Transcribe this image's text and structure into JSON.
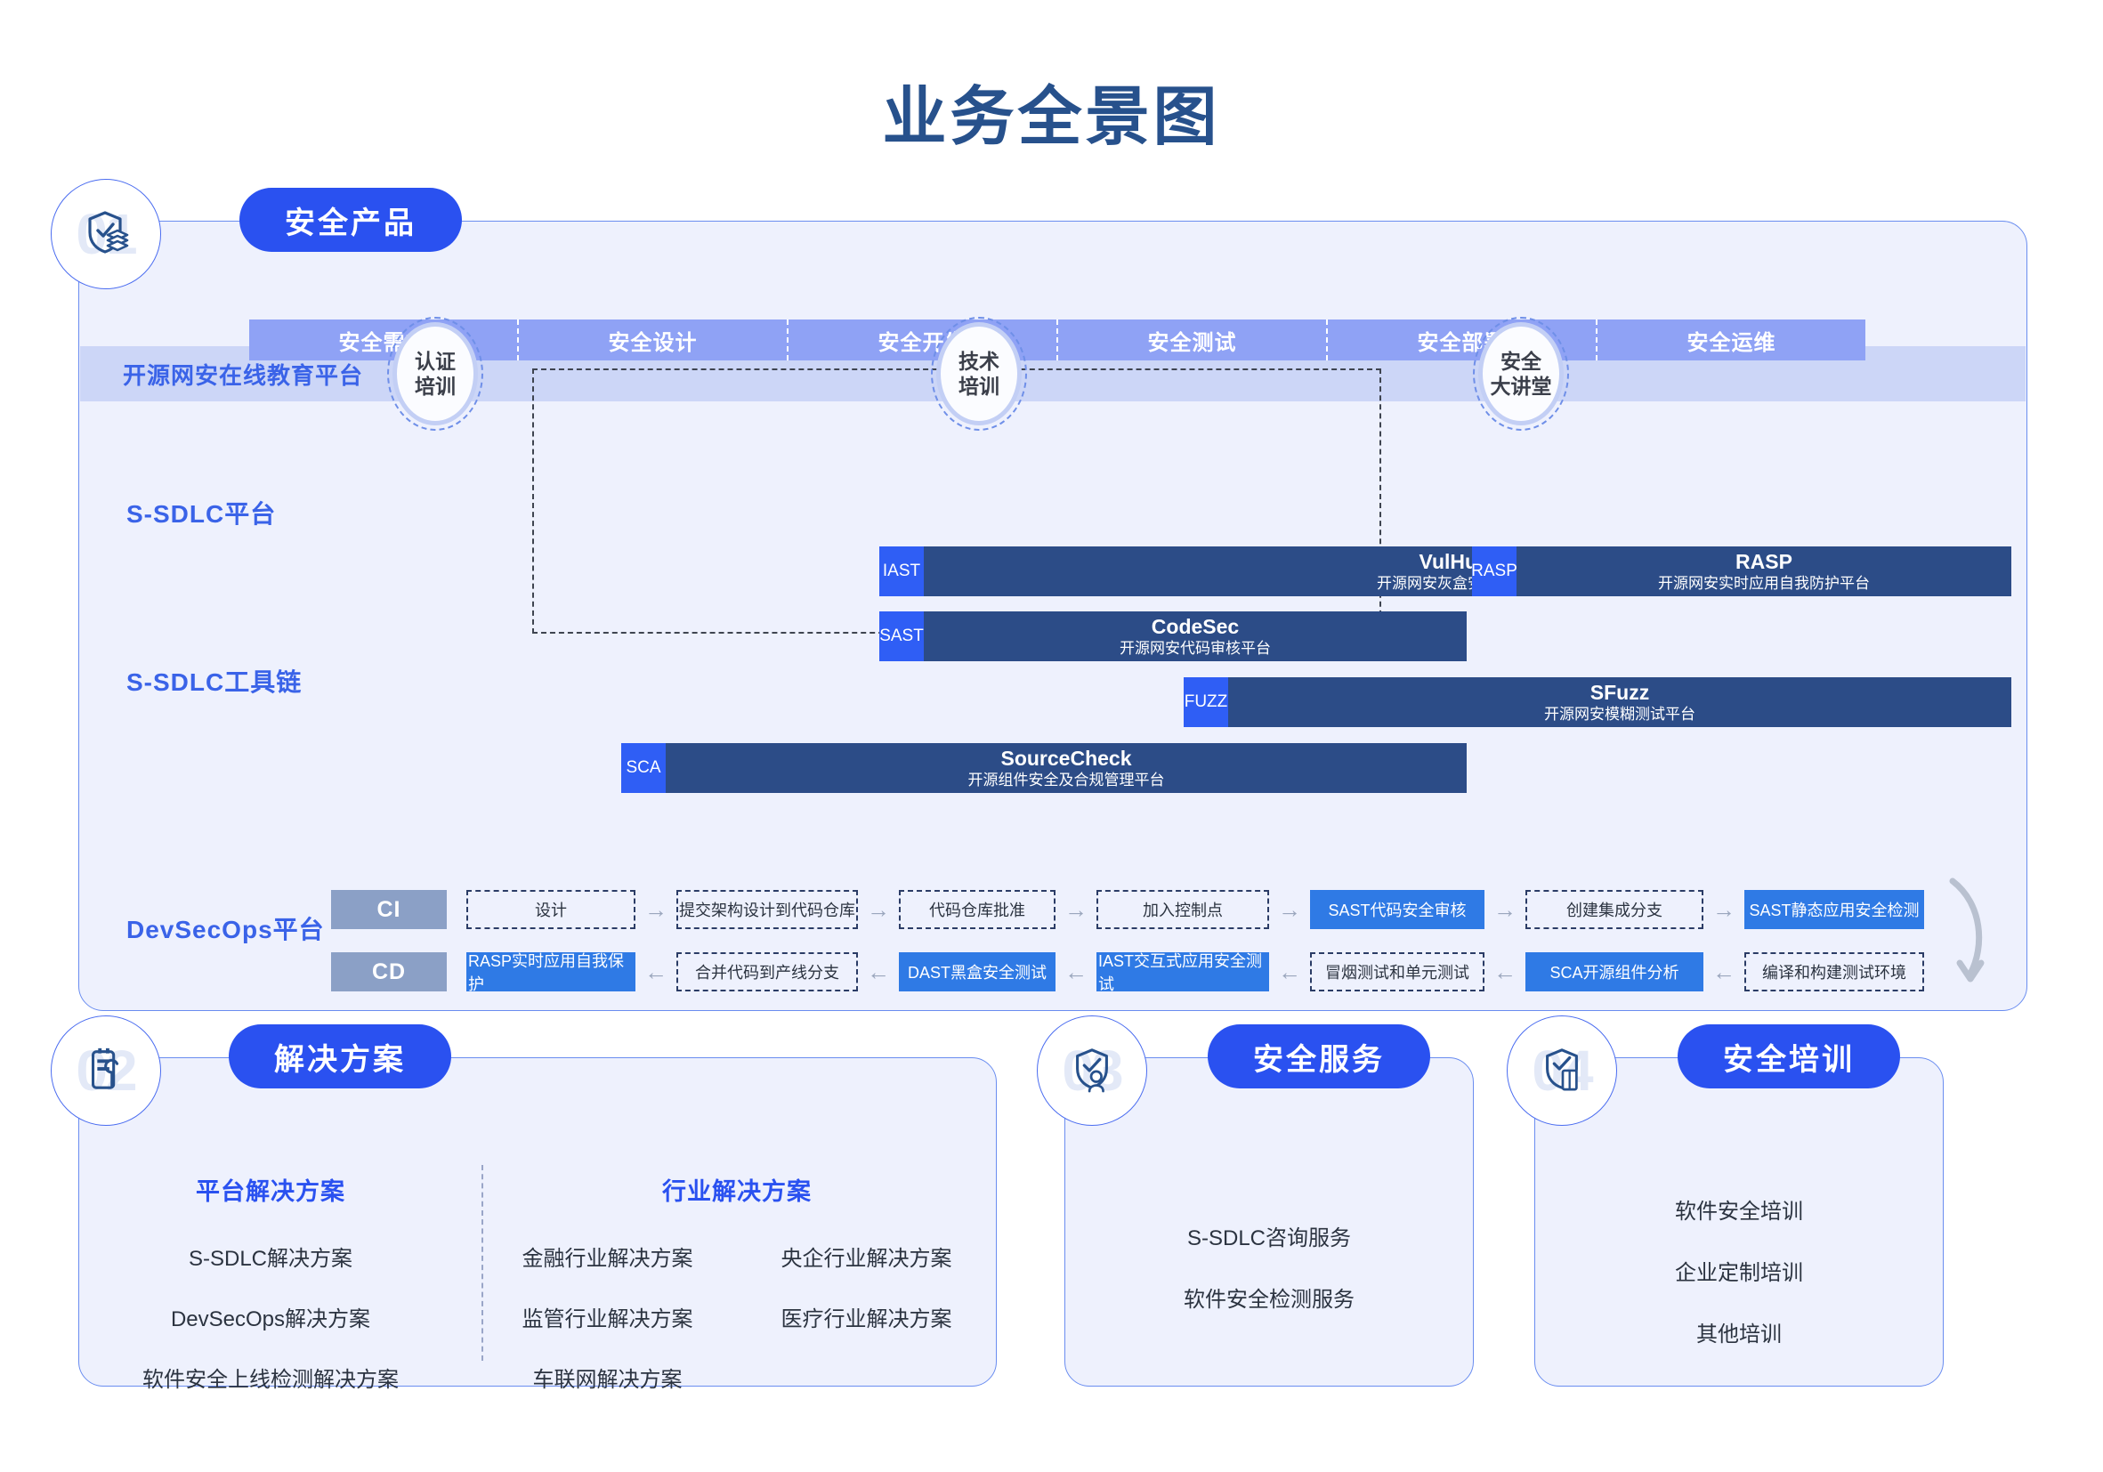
{
  "page": {
    "title": "业务全景图",
    "title_color": "#27518c",
    "accent_color": "#2a51f0",
    "panel_bg": "#eef1fd"
  },
  "section01": {
    "number": "01",
    "icon": "shield-layers-icon",
    "pill_label": "安全产品",
    "education": {
      "label": "开源网安在线教育平台",
      "circles": [
        {
          "line1": "认证",
          "line2": "培训"
        },
        {
          "line1": "技术",
          "line2": "培训"
        },
        {
          "line1": "安全",
          "line2": "大讲堂"
        }
      ]
    },
    "sdlc_platform": {
      "label": "S-SDLC平台",
      "stages": [
        "安全需求",
        "安全设计",
        "安全开发",
        "安全测试",
        "安全部署",
        "安全运维"
      ]
    },
    "toolchain": {
      "label": "S-SDLC工具链",
      "tools": [
        {
          "tag": "IAST",
          "name": "VulHunter",
          "desc": "开源网安灰盒安全测试平台"
        },
        {
          "tag": "RASP",
          "name": "RASP",
          "desc": "开源网安实时应用自我防护平台"
        },
        {
          "tag": "SAST",
          "name": "CodeSec",
          "desc": "开源网安代码审核平台"
        },
        {
          "tag": "FUZZ",
          "name": "SFuzz",
          "desc": "开源网安模糊测试平台"
        },
        {
          "tag": "SCA",
          "name": "SourceCheck",
          "desc": "开源组件安全及合规管理平台"
        }
      ]
    },
    "devsecops": {
      "label": "DevSecOps平台",
      "ci_tag": "CI",
      "cd_tag": "CD",
      "ci_steps": [
        {
          "text": "设计",
          "style": "dashed"
        },
        {
          "text": "提交架构设计到代码仓库",
          "style": "dashed"
        },
        {
          "text": "代码仓库批准",
          "style": "dashed"
        },
        {
          "text": "加入控制点",
          "style": "dashed"
        },
        {
          "text": "SAST代码安全审核",
          "style": "solid"
        },
        {
          "text": "创建集成分支",
          "style": "dashed"
        },
        {
          "text": "SAST静态应用安全检测",
          "style": "solid"
        }
      ],
      "cd_steps": [
        {
          "text": "RASP实时应用自我保护",
          "style": "solid"
        },
        {
          "text": "合并代码到产线分支",
          "style": "dashed"
        },
        {
          "text": "DAST黑盒安全测试",
          "style": "solid"
        },
        {
          "text": "IAST交互式应用安全测试",
          "style": "solid"
        },
        {
          "text": "冒烟测试和单元测试",
          "style": "dashed"
        },
        {
          "text": "SCA开源组件分析",
          "style": "solid"
        },
        {
          "text": "编译和构建测试环境",
          "style": "dashed"
        }
      ],
      "ci_arrow": "→",
      "cd_arrow": "←"
    }
  },
  "section02": {
    "number": "02",
    "icon": "toolbox-wrench-icon",
    "pill_label": "解决方案",
    "platform_head": "平台解决方案",
    "platform_items": [
      "S-SDLC解决方案",
      "DevSecOps解决方案",
      "软件安全上线检测解决方案"
    ],
    "industry_head": "行业解决方案",
    "industry_items": [
      "金融行业解决方案",
      "央企行业解决方案",
      "监管行业解决方案",
      "医疗行业解决方案",
      "车联网解决方案",
      ""
    ]
  },
  "section03": {
    "number": "03",
    "icon": "shield-person-icon",
    "pill_label": "安全服务",
    "items": [
      "S-SDLC咨询服务",
      "软件安全检测服务"
    ]
  },
  "section04": {
    "number": "04",
    "icon": "shield-book-icon",
    "pill_label": "安全培训",
    "items": [
      "软件安全培训",
      "企业定制培训",
      "其他培训"
    ]
  }
}
